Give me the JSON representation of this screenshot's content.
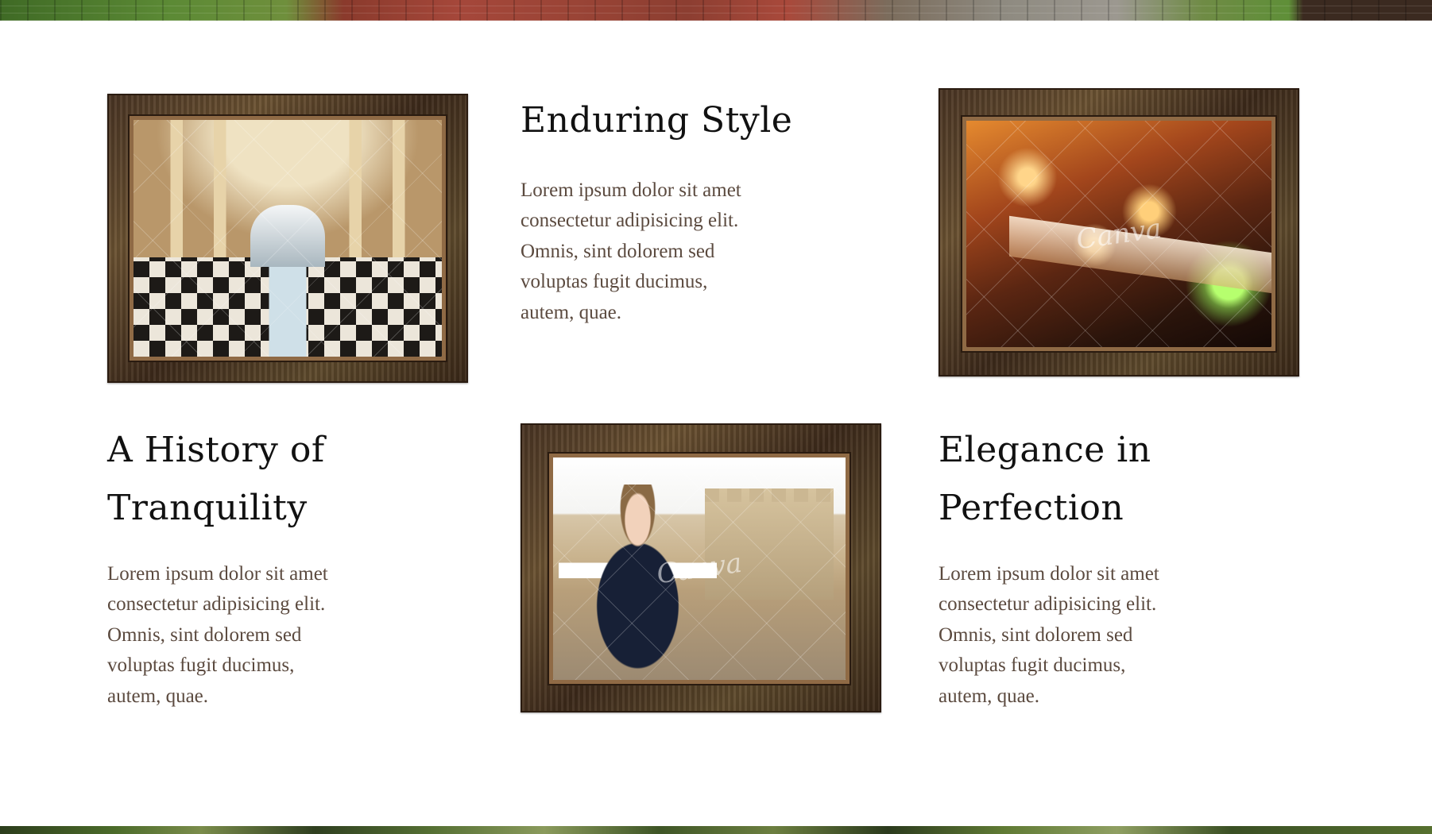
{
  "sections": [
    {
      "heading": "Enduring Style",
      "body": "Lorem ipsum dolor sit amet consectetur adipisicing elit. Omnis, sint dolorem sed voluptas fugit ducimus, autem, quae."
    },
    {
      "heading": "A History of Tranquility",
      "body": "Lorem ipsum dolor sit amet consectetur adipisicing elit. Omnis, sint dolorem sed voluptas fugit ducimus, autem, quae."
    },
    {
      "heading": "Elegance in Perfection",
      "body": "Lorem ipsum dolor sit amet consectetur adipisicing elit. Omnis, sint dolorem sed voluptas fugit ducimus, autem, quae."
    }
  ],
  "images": {
    "palace_hall": {
      "alt": "Ornate palace hall with chandeliers in a wooden frame"
    },
    "restaurant": {
      "alt": "Candlelit restaurant table in a wooden frame"
    },
    "woman": {
      "alt": "Woman in blazer posing by a castle in a wooden frame"
    }
  },
  "watermark": "Canva"
}
